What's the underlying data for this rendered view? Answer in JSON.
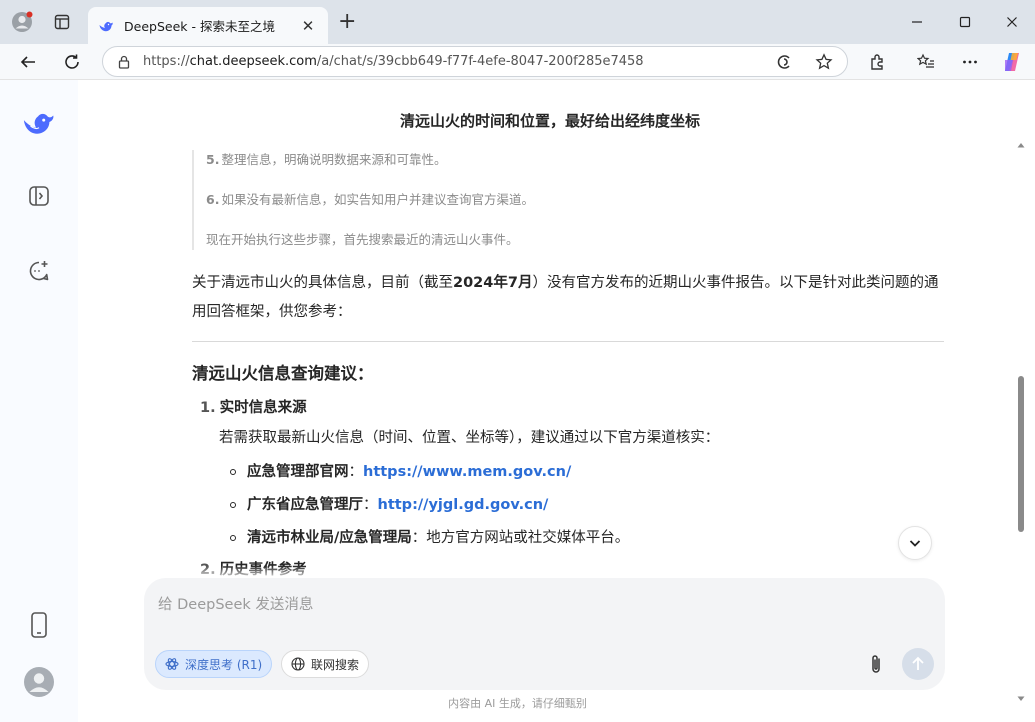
{
  "browser": {
    "tab_title": "DeepSeek - 探索未至之境",
    "url_prefix": "https://",
    "url_domain": "chat.deepseek.com",
    "url_path": "/a/chat/s/39cbb649-f77f-4efe-8047-200f285e7458",
    "new_tab_glyph": "+",
    "close_tab_glyph": "✕"
  },
  "chat": {
    "title": "清远山火的时间和位置，最好给出经纬度坐标",
    "thinking": [
      {
        "num": "5.",
        "text": "整理信息，明确说明数据来源和可靠性。"
      },
      {
        "num": "6.",
        "text": "如果没有最新信息，如实告知用户并建议查询官方渠道。"
      },
      {
        "num": "",
        "text": "现在开始执行这些步骤，首先搜索最近的清远山火事件。"
      }
    ],
    "intro_a": "关于清远市山火的具体信息，目前（截至",
    "intro_b": "2024年7月",
    "intro_c": "）没有官方发布的近期山火事件报告。以下是针对此类问题的通用回答框架，供您参考：",
    "section_heading": "清远山火信息查询建议：",
    "item1_num": "1.",
    "item1_title": "实时信息来源",
    "item1_desc": "若需获取最新山火信息（时间、位置、坐标等），建议通过以下官方渠道核实：",
    "bullets": [
      {
        "key": "应急管理部官网",
        "sep": "：",
        "value": "https://www.mem.gov.cn/",
        "is_link": true
      },
      {
        "key": "广东省应急管理厅",
        "sep": "：",
        "value": "http://yjgl.gd.gov.cn/",
        "is_link": true
      },
      {
        "key": "清远市林业局/应急管理局",
        "sep": "：",
        "value": "地方官方网站或社交媒体平台。",
        "is_link": false
      }
    ],
    "item2_num": "2.",
    "item2_title": "历史事件参考"
  },
  "composer": {
    "placeholder": "给 DeepSeek 发送消息",
    "deep_think_label": "深度思考 (R1)",
    "web_search_label": "联网搜索"
  },
  "footer": "内容由 AI 生成，请仔细甄别",
  "colors": {
    "accent": "#4d6bfe",
    "link": "#2b6dd6"
  }
}
